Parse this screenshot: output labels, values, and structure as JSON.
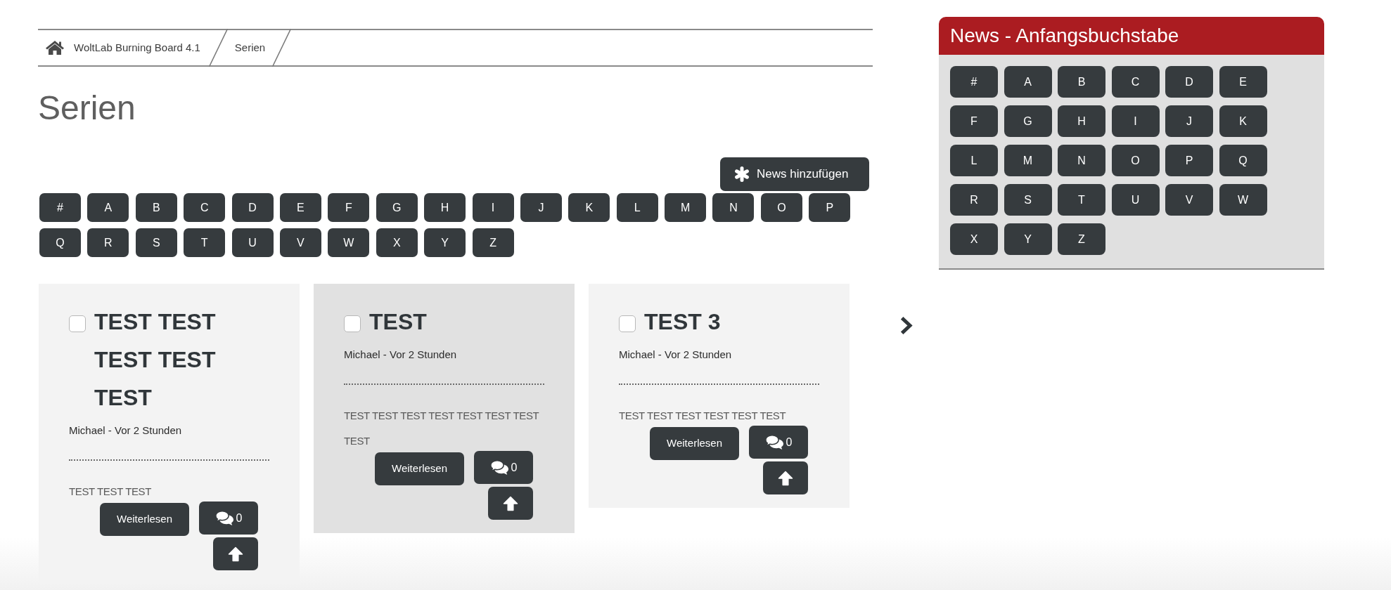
{
  "breadcrumb": [
    {
      "kind": "home",
      "label": "WoltLab Burning Board 4.1"
    },
    {
      "kind": "page",
      "label": "Serien"
    }
  ],
  "page_title": "Serien",
  "add_button": {
    "label": "News hinzufügen"
  },
  "letter_filter": [
    "#",
    "A",
    "B",
    "C",
    "D",
    "E",
    "F",
    "G",
    "H",
    "I",
    "J",
    "K",
    "L",
    "M",
    "N",
    "O",
    "P",
    "Q",
    "R",
    "S",
    "T",
    "U",
    "V",
    "W",
    "X",
    "Y",
    "Z"
  ],
  "cards": [
    {
      "title": "TEST TEST TEST TEST TEST",
      "checked": false,
      "highlighted": false,
      "meta": "Michael - Vor 2 Stunden",
      "excerpt": "TEST TEST TEST",
      "read_more": "Weiterlesen",
      "comments": "0"
    },
    {
      "title": "TEST",
      "checked": false,
      "highlighted": true,
      "meta": "Michael - Vor 2 Stunden",
      "excerpt": "TEST TEST TEST TEST TEST TEST TEST TEST",
      "read_more": "Weiterlesen",
      "comments": "0"
    },
    {
      "title": "TEST 3",
      "checked": false,
      "highlighted": false,
      "meta": "Michael - Vor 2 Stunden",
      "excerpt": "TEST TEST TEST TEST TEST TEST",
      "read_more": "Weiterlesen",
      "comments": "0"
    }
  ],
  "sidebar": {
    "title": "News - Anfangsbuchstabe",
    "letters": [
      "#",
      "A",
      "B",
      "C",
      "D",
      "E",
      "F",
      "G",
      "H",
      "I",
      "J",
      "K",
      "L",
      "M",
      "N",
      "O",
      "P",
      "Q",
      "R",
      "S",
      "T",
      "U",
      "V",
      "W",
      "X",
      "Y",
      "Z"
    ]
  }
}
